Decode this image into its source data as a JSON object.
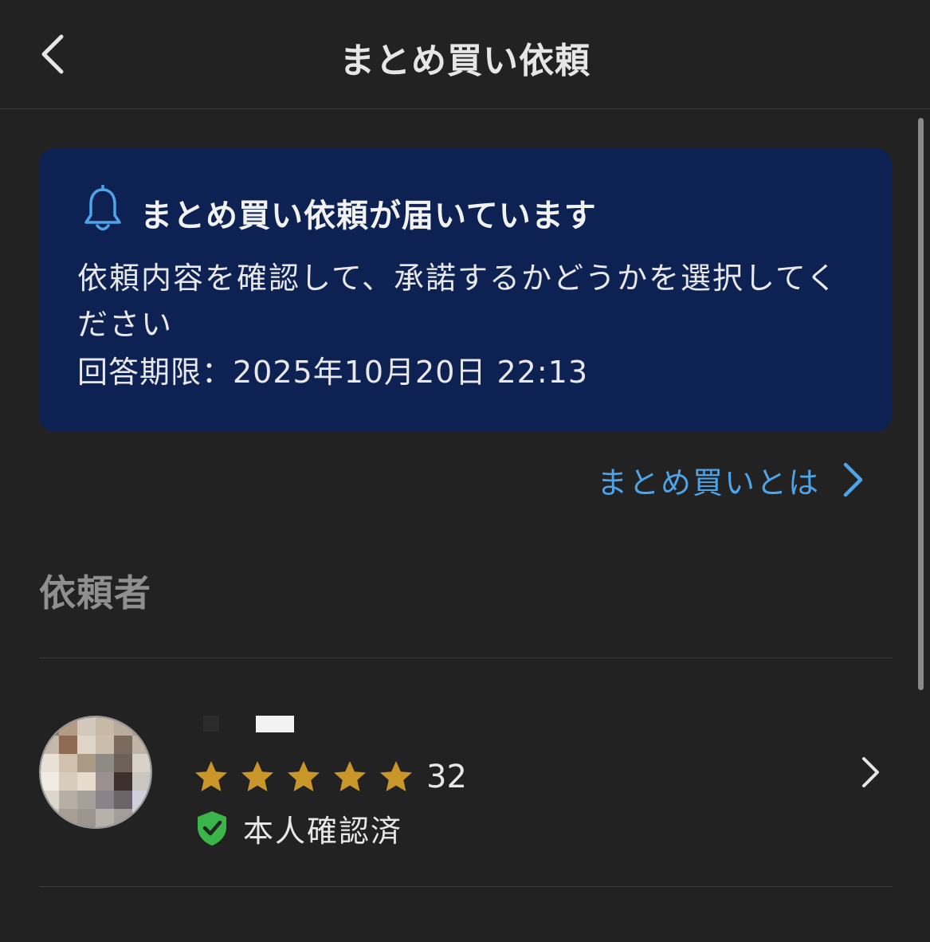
{
  "header": {
    "title": "まとめ買い依頼",
    "back_icon": "chevron-left-icon"
  },
  "notice": {
    "icon": "bell-icon",
    "title": "まとめ買い依頼が届いています",
    "body": "依頼内容を確認して、承諾するかどうかを選択してください",
    "deadline": "回答期限：2025年10月20日 22:13"
  },
  "about_link": {
    "label": "まとめ買いとは",
    "icon": "chevron-right-icon"
  },
  "requester_section": {
    "heading": "依頼者"
  },
  "requester": {
    "rating": 5,
    "rating_max": 5,
    "review_count": "32",
    "verified_label": "本人確認済",
    "verified_icon": "shield-check-icon"
  },
  "colors": {
    "background": "#222222",
    "notice_background": "#0d2252",
    "accent_blue": "#4ea4e8",
    "star_gold": "#c9962a",
    "verified_green": "#3bb54a",
    "heading_gray": "#8f8f8f"
  }
}
